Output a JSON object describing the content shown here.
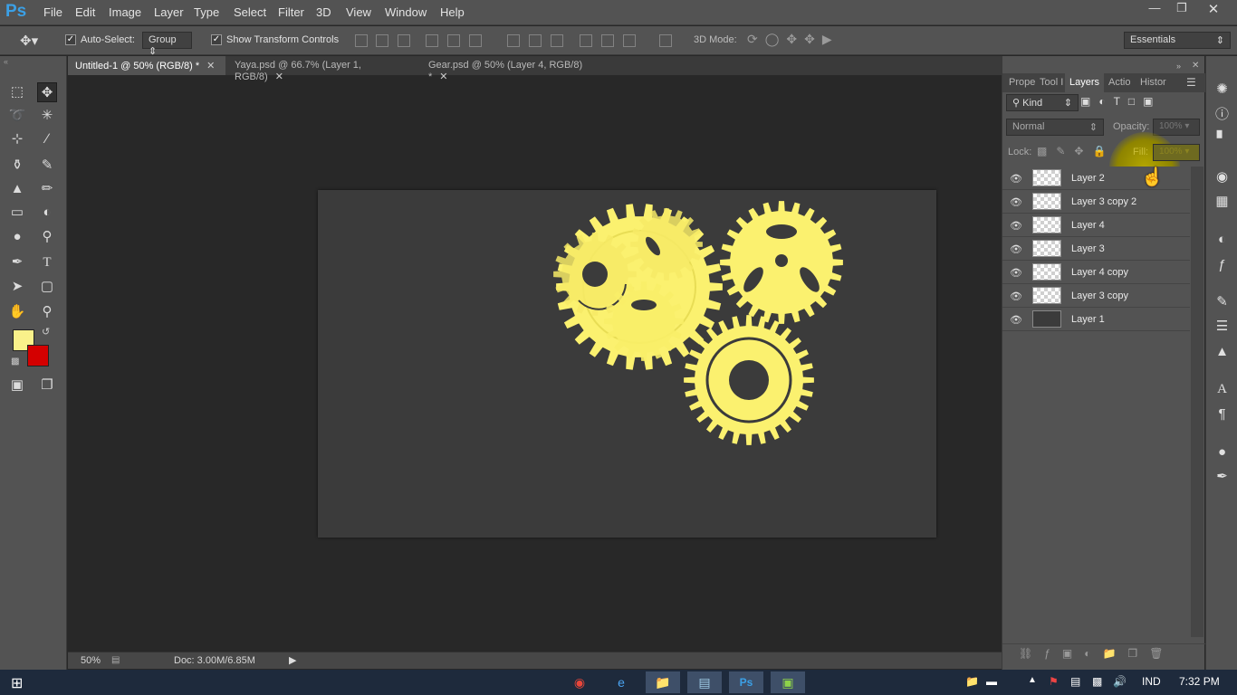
{
  "app": {
    "logo": "Ps"
  },
  "menu": [
    "File",
    "Edit",
    "Image",
    "Layer",
    "Type",
    "Select",
    "Filter",
    "3D",
    "View",
    "Window",
    "Help"
  ],
  "window_controls": {
    "minimize_icon": "minimize-icon",
    "restore_icon": "restore-icon",
    "close_icon": "close-icon"
  },
  "options": {
    "auto_select_label": "Auto-Select:",
    "auto_select_checked": true,
    "auto_select_target": "Group",
    "show_transform_label": "Show Transform Controls",
    "show_transform_checked": true,
    "mode_3d_label": "3D Mode:",
    "workspace": "Essentials"
  },
  "doc_tabs": [
    {
      "label": "Untitled-1 @ 50% (RGB/8) *",
      "active": true
    },
    {
      "label": "Yaya.psd @ 66.7% (Layer 1, RGB/8)",
      "active": false
    },
    {
      "label": "Gear.psd @ 50% (Layer 4, RGB/8) *",
      "active": false
    }
  ],
  "colors": {
    "foreground": "#f9f18a",
    "background": "#d40000",
    "gear": "#fbf16f",
    "canvas": "#3b3b3b"
  },
  "status": {
    "zoom": "50%",
    "doc": "Doc: 3.00M/6.85M"
  },
  "panel": {
    "tabs": [
      {
        "label": "Prope",
        "active": false
      },
      {
        "label": "Tool I",
        "active": false
      },
      {
        "label": "Layers",
        "active": true
      },
      {
        "label": "Actio",
        "active": false
      },
      {
        "label": "Histor",
        "active": false
      }
    ],
    "filter_kind": "Kind",
    "blend_mode": "Normal",
    "opacity_label": "Opacity:",
    "opacity_value": "100%",
    "lock_label": "Lock:",
    "fill_label": "Fill:",
    "fill_value": "100%",
    "layers": [
      {
        "name": "Layer 2",
        "visible": true,
        "thumb": "transparent"
      },
      {
        "name": "Layer 3 copy 2",
        "visible": true,
        "thumb": "transparent"
      },
      {
        "name": "Layer 4",
        "visible": true,
        "thumb": "transparent"
      },
      {
        "name": "Layer 3",
        "visible": true,
        "thumb": "transparent"
      },
      {
        "name": "Layer 4 copy",
        "visible": true,
        "thumb": "transparent"
      },
      {
        "name": "Layer 3 copy",
        "visible": true,
        "thumb": "transparent"
      },
      {
        "name": "Layer 1",
        "visible": true,
        "thumb": "dark"
      }
    ]
  },
  "taskbar": {
    "apps": [
      "chrome-icon",
      "ie-icon",
      "explorer-icon",
      "notepad-icon",
      "photoshop-icon",
      "camtasia-icon"
    ],
    "language": "IND",
    "time": "7:32 PM"
  }
}
